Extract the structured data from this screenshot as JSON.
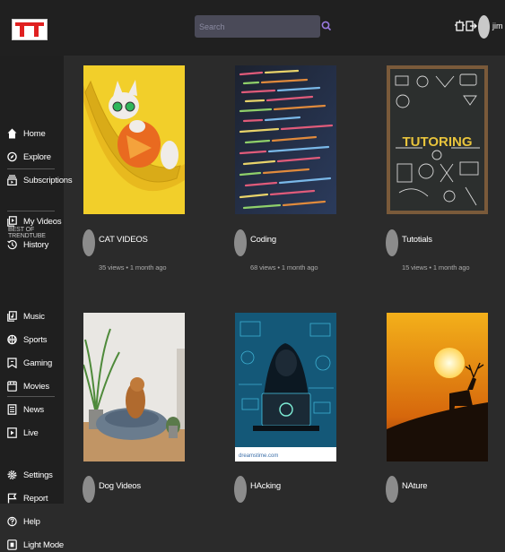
{
  "header": {
    "logo_letters": "TT",
    "search_placeholder": "Search",
    "username": "jim"
  },
  "sidebar": {
    "primary": [
      {
        "label": "Home",
        "icon": "home-icon"
      },
      {
        "label": "Explore",
        "icon": "compass-icon"
      },
      {
        "label": "Subscriptions",
        "icon": "subscriptions-icon"
      }
    ],
    "library": [
      {
        "label": "My Videos",
        "icon": "video-library-icon"
      },
      {
        "label": "History",
        "icon": "history-icon"
      }
    ],
    "section_title": "BEST OF TRENDTUBE",
    "categories": [
      {
        "label": "Music",
        "icon": "music-icon"
      },
      {
        "label": "Sports",
        "icon": "sports-icon"
      },
      {
        "label": "Gaming",
        "icon": "gaming-icon"
      },
      {
        "label": "Movies",
        "icon": "movies-icon"
      },
      {
        "label": "News",
        "icon": "news-icon"
      },
      {
        "label": "Live",
        "icon": "live-icon"
      }
    ],
    "bottom": [
      {
        "label": "Settings",
        "icon": "gear-icon"
      },
      {
        "label": "Report",
        "icon": "flag-icon"
      },
      {
        "label": "Help",
        "icon": "help-icon"
      },
      {
        "label": "Light Mode",
        "icon": "light-mode-icon"
      }
    ]
  },
  "videos": [
    {
      "title": "CAT VIDEOS",
      "meta": "35 views • 1 month ago",
      "thumbnail": "cat-in-hammock"
    },
    {
      "title": "Coding",
      "meta": "68 views • 1 month ago",
      "thumbnail": "code-screen"
    },
    {
      "title": "Tutotials",
      "meta": "15 views • 1 month ago",
      "thumbnail": "tutoring-chalkboard"
    },
    {
      "title": "Dog Videos",
      "meta": "",
      "thumbnail": "dog-in-bed"
    },
    {
      "title": "HAcking",
      "meta": "",
      "thumbnail": "hacker-laptop"
    },
    {
      "title": "NAture",
      "meta": "",
      "thumbnail": "deer-sunset"
    }
  ],
  "thumbnail_text": {
    "tutoring": "TUTORING",
    "watermark": "dreamstime.com"
  }
}
